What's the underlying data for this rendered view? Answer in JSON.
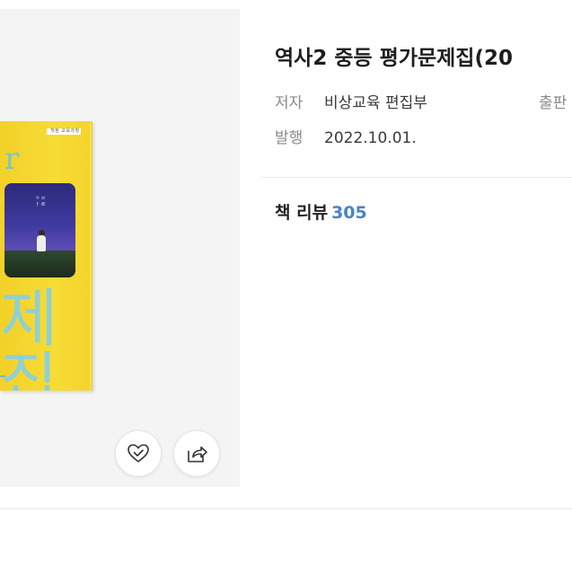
{
  "book": {
    "title": "역사2 중등 평가문제집(20",
    "author_label": "저자",
    "author": "비상교육 편집부",
    "publisher_label": "출판",
    "date_label": "발행",
    "date": "2022.10.01."
  },
  "review": {
    "label": "책 리뷰",
    "count": "305",
    "count_color": "#4a82c9"
  },
  "cover": {
    "badge_text": "개정 교육과정",
    "letter": "r",
    "big_text": "제집",
    "photo_caption": "ㅇ ㅂ ㅏ 르",
    "background_color": "#f4d42c"
  },
  "actions": {
    "like_icon": "heart-check-icon",
    "share_icon": "share-icon"
  }
}
